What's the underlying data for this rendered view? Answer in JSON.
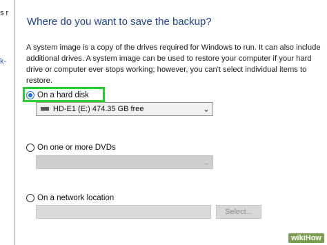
{
  "background_window": {
    "fragments": [
      "s r",
      "k-"
    ]
  },
  "dialog": {
    "heading": "Where do you want to save the backup?",
    "description": "A system image is a copy of the drives required for Windows to run. It can also include additional drives. A system image can be used to restore your computer if your hard drive or computer ever stops working; however, you can't select individual items to restore.",
    "options": {
      "hard_disk": {
        "label": "On a hard disk",
        "selected": true,
        "drive_value": "HD-E1 (E:)  474.35 GB free"
      },
      "dvds": {
        "label": "On one or more DVDs",
        "selected": false,
        "drive_value": ""
      },
      "network": {
        "label": "On a network location",
        "selected": false,
        "location_value": "",
        "select_button_label": "Select..."
      }
    },
    "highlight_color": "#22d42a"
  },
  "watermark": "wikiHow",
  "icons": {
    "drive": "drive-icon",
    "dropdown": "chevron-down-icon"
  }
}
